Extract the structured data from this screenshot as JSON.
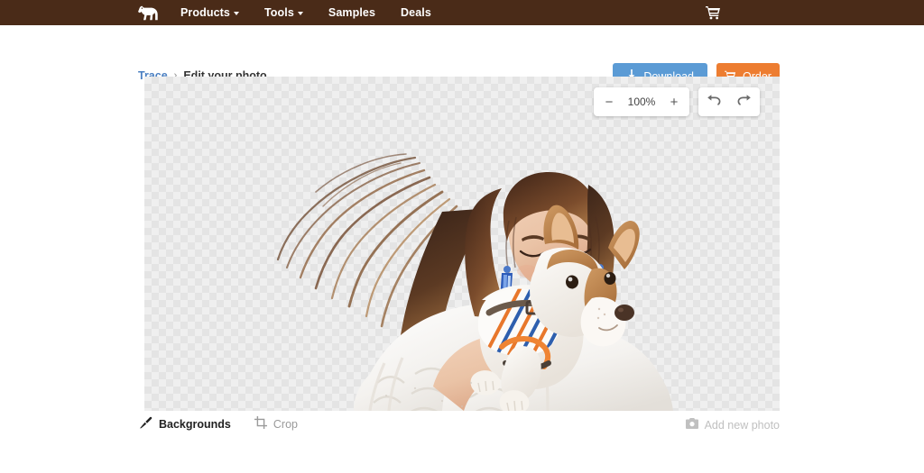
{
  "nav": {
    "logo_icon": "horse-logo-icon",
    "items": [
      {
        "label": "Products",
        "has_caret": true
      },
      {
        "label": "Tools",
        "has_caret": true
      },
      {
        "label": "Samples",
        "has_caret": false
      },
      {
        "label": "Deals",
        "has_caret": false
      }
    ],
    "cart_icon": "shopping-cart-icon",
    "background": "#4a2b18"
  },
  "breadcrumb": {
    "root": "Trace",
    "separator": "›",
    "current": "Edit your photo",
    "link_color": "#4a7fc1"
  },
  "actions": {
    "download": {
      "label": "Download",
      "icon": "download-icon",
      "color": "#5b9bd5"
    },
    "order": {
      "label": "Order",
      "icon": "cart-icon",
      "color": "#ed7d31"
    }
  },
  "editor": {
    "zoom": {
      "minus_label": "−",
      "level": "100%",
      "plus_label": "+"
    },
    "history": {
      "undo_icon": "undo-arrow-icon",
      "redo_icon": "redo-arrow-icon"
    },
    "canvas": {
      "transparency_checker": true,
      "photo_subject": "woman holding a chihuahua dog"
    }
  },
  "toolbar": {
    "left": [
      {
        "label": "Backgrounds",
        "icon": "brush-icon",
        "state": "active"
      },
      {
        "label": "Crop",
        "icon": "crop-icon",
        "state": "inactive"
      }
    ],
    "right": {
      "label": "Add new photo",
      "icon": "camera-icon"
    }
  }
}
